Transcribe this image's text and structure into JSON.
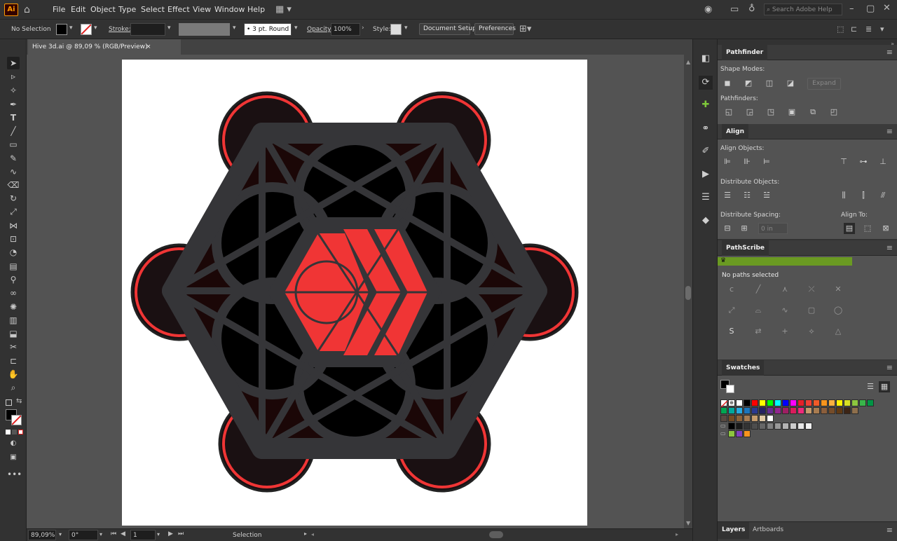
{
  "app": {
    "logo": "Ai"
  },
  "menus": [
    "File",
    "Edit",
    "Object",
    "Type",
    "Select",
    "Effect",
    "View",
    "Window",
    "Help"
  ],
  "menubar": {
    "search_placeholder": "Search Adobe Help"
  },
  "control": {
    "selection": "No Selection",
    "stroke_label": "Stroke:",
    "brush": "3 pt. Round",
    "opacity_label": "Opacity:",
    "opacity": "100%",
    "style_label": "Style:",
    "doc_setup": "Document Setup",
    "preferences": "Preferences"
  },
  "document": {
    "tab_title": "Hive 3d.ai @ 89,09 % (RGB/Preview)",
    "close": "×"
  },
  "status": {
    "zoom": "89,09%",
    "angle": "0°",
    "page": "1",
    "tool": "Selection"
  },
  "panels": {
    "pathfinder": {
      "title": "Pathfinder",
      "shape_modes": "Shape Modes:",
      "expand": "Expand",
      "pathfinders": "Pathfinders:"
    },
    "align": {
      "title": "Align",
      "align_objects": "Align Objects:",
      "distribute_objects": "Distribute Objects:",
      "distribute_spacing": "Distribute Spacing:",
      "align_to": "Align To:",
      "spacing_value": "0 in"
    },
    "pathscribe": {
      "title": "PathScribe",
      "status": "No paths selected",
      "s_label": "S"
    },
    "swatches": {
      "title": "Swatches"
    },
    "bottom_tabs": {
      "layers": "Layers",
      "artboards": "Artboards"
    }
  },
  "colors": {
    "accent_red": "#f03535",
    "dark_hex": "#353538",
    "pathscribe_green": "#6a9a22"
  },
  "swatch_rows": [
    [
      "#ffffff",
      "#000000",
      "#ff0000",
      "#ffff00",
      "#00ff00",
      "#00ffff",
      "#0000ff",
      "#ff00ff",
      "#e4202a",
      "#ee4034",
      "#f05a28",
      "#f7941d",
      "#fbb040",
      "#fff200",
      "#d7df23",
      "#8dc63f",
      "#39b54a",
      "#009444"
    ],
    [
      "#00a651",
      "#00a99d",
      "#27aae1",
      "#1c75bc",
      "#2b3990",
      "#262262",
      "#662d91",
      "#92278f",
      "#9e1f63",
      "#da1c5c",
      "#ee2a7b",
      "#c49a6c",
      "#a97c50",
      "#8b5e3c",
      "#754c29",
      "#603913",
      "#3c2415",
      "#8e6f4c"
    ],
    [
      "#594a42",
      "#754c24",
      "#8c6239",
      "#a67c52",
      "#c69c6d",
      "#e0c9a6",
      "#fff"
    ],
    [
      "#000000",
      "#1a1a1a",
      "#333333",
      "#4d4d4d",
      "#666666",
      "#808080",
      "#999999",
      "#b3b3b3",
      "#cccccc",
      "#e6e6e6",
      "#f2f2f2"
    ],
    [
      "#8dc63f",
      "#7f3fbf",
      "#f7941d"
    ]
  ]
}
